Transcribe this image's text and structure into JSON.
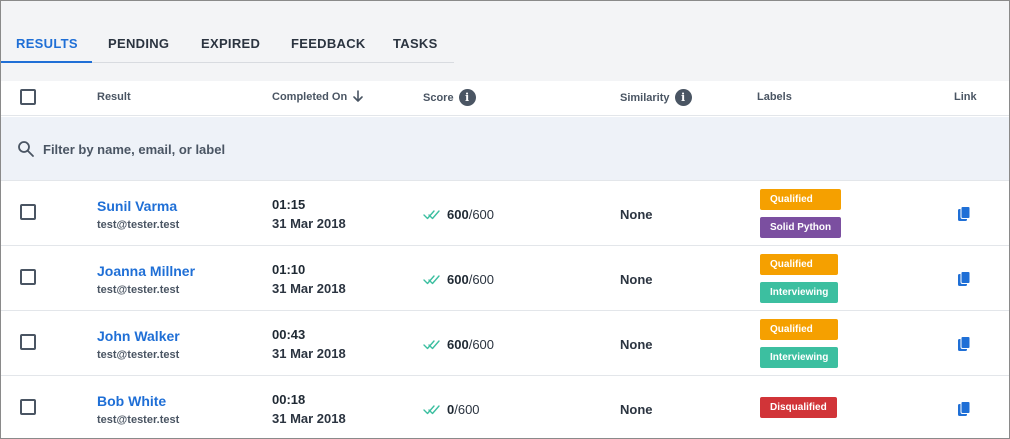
{
  "tabs": [
    "RESULTS",
    "PENDING",
    "EXPIRED",
    "FEEDBACK",
    "TASKS"
  ],
  "active_tab": "RESULTS",
  "columns": {
    "result": "Result",
    "completed_on": "Completed On",
    "score": "Score",
    "similarity": "Similarity",
    "labels": "Labels",
    "link": "Link"
  },
  "filter": {
    "placeholder": "Filter by name, email, or label"
  },
  "rows": [
    {
      "name": "Sunil Varma",
      "email": "test@tester.test",
      "time": "01:15",
      "date": "31 Mar 2018",
      "score": "600",
      "score_max": "/600",
      "similarity": "None",
      "labels": [
        {
          "text": "Qualified",
          "color": "#f5a000"
        },
        {
          "text": "Solid Python",
          "color": "#7b4fa0"
        }
      ]
    },
    {
      "name": "Joanna Millner",
      "email": "test@tester.test",
      "time": "01:10",
      "date": "31 Mar 2018",
      "score": "600",
      "score_max": "/600",
      "similarity": "None",
      "labels": [
        {
          "text": "Qualified",
          "color": "#f5a000"
        },
        {
          "text": "Interviewing",
          "color": "#3cbfa0"
        }
      ]
    },
    {
      "name": "John Walker",
      "email": "test@tester.test",
      "time": "00:43",
      "date": "31 Mar 2018",
      "score": "600",
      "score_max": "/600",
      "similarity": "None",
      "labels": [
        {
          "text": "Qualified",
          "color": "#f5a000"
        },
        {
          "text": "Interviewing",
          "color": "#3cbfa0"
        }
      ]
    },
    {
      "name": "Bob White",
      "email": "test@tester.test",
      "time": "00:18",
      "date": "31 Mar 2018",
      "score": "0",
      "score_max": "/600",
      "similarity": "None",
      "labels": [
        {
          "text": "Disqualified",
          "color": "#d13438"
        }
      ]
    }
  ],
  "colors": {
    "accent": "#1f6fd6",
    "check": "#3cbfa0"
  },
  "icons": {
    "sort": "arrow-down-icon",
    "info": "info-icon",
    "search": "search-icon",
    "score": "double-check-icon",
    "link": "copy-icon"
  }
}
